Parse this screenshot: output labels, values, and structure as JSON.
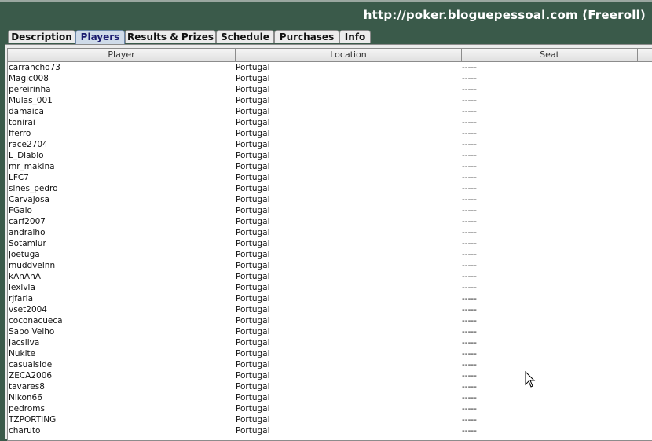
{
  "header": {
    "title": "http://poker.bloguepessoal.com (Freeroll)"
  },
  "tabs": [
    {
      "label": "Description"
    },
    {
      "label": "Players"
    },
    {
      "label": "Results & Prizes"
    },
    {
      "label": "Schedule"
    },
    {
      "label": "Purchases"
    },
    {
      "label": "Info"
    }
  ],
  "active_tab": "Players",
  "table": {
    "columns": [
      "Player",
      "Location",
      "Seat"
    ],
    "rows": [
      [
        "carrancho73",
        "Portugal",
        "-----"
      ],
      [
        "Magic008",
        "Portugal",
        "-----"
      ],
      [
        "pereirinha",
        "Portugal",
        "-----"
      ],
      [
        "Mulas_001",
        "Portugal",
        "-----"
      ],
      [
        "damaica",
        "Portugal",
        "-----"
      ],
      [
        "tonirai",
        "Portugal",
        "-----"
      ],
      [
        "fferro",
        "Portugal",
        "-----"
      ],
      [
        "race2704",
        "Portugal",
        "-----"
      ],
      [
        "L_Diablo",
        "Portugal",
        "-----"
      ],
      [
        "mr_makina",
        "Portugal",
        "-----"
      ],
      [
        "LFC7",
        "Portugal",
        "-----"
      ],
      [
        "sines_pedro",
        "Portugal",
        "-----"
      ],
      [
        "Carvajosa",
        "Portugal",
        "-----"
      ],
      [
        "FGaio",
        "Portugal",
        "-----"
      ],
      [
        "carf2007",
        "Portugal",
        "-----"
      ],
      [
        "andralho",
        "Portugal",
        "-----"
      ],
      [
        "Sotamiur",
        "Portugal",
        "-----"
      ],
      [
        "joetuga",
        "Portugal",
        "-----"
      ],
      [
        "muddveinn",
        "Portugal",
        "-----"
      ],
      [
        "kAnAnA",
        "Portugal",
        "-----"
      ],
      [
        "lexivia",
        "Portugal",
        "-----"
      ],
      [
        "rjfaria",
        "Portugal",
        "-----"
      ],
      [
        "vset2004",
        "Portugal",
        "-----"
      ],
      [
        "coconacueca",
        "Portugal",
        "-----"
      ],
      [
        "Sapo Velho",
        "Portugal",
        "-----"
      ],
      [
        "Jacsilva",
        "Portugal",
        "-----"
      ],
      [
        "Nukite",
        "Portugal",
        "-----"
      ],
      [
        "casualside",
        "Portugal",
        "-----"
      ],
      [
        "ZECA2006",
        "Portugal",
        "-----"
      ],
      [
        "tavares8",
        "Portugal",
        "-----"
      ],
      [
        "Nikon66",
        "Portugal",
        "-----"
      ],
      [
        "pedromsl",
        "Portugal",
        "-----"
      ],
      [
        "TZPORTING",
        "Portugal",
        "-----"
      ],
      [
        "charuto",
        "Portugal",
        "-----"
      ]
    ]
  }
}
